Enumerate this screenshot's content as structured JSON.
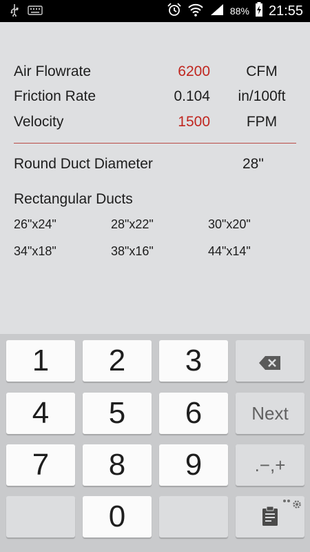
{
  "status_bar": {
    "battery_percent": "88%",
    "time": "21:55",
    "icons": [
      "usb-icon",
      "keyboard-icon",
      "alarm-icon",
      "wifi-icon",
      "signal-icon",
      "battery-charging-icon"
    ]
  },
  "calc": {
    "rows": [
      {
        "label": "Air Flowrate",
        "value": "6200",
        "unit": "CFM",
        "color": "#c0261f"
      },
      {
        "label": "Friction Rate",
        "value": "0.104",
        "unit": "in/100ft",
        "color": "#1d1d1d"
      },
      {
        "label": "Velocity",
        "value": "1500",
        "unit": "FPM",
        "color": "#c0261f"
      }
    ],
    "round_duct": {
      "label": "Round Duct Diameter",
      "value": "28\""
    },
    "rectangular": {
      "title": "Rectangular Ducts",
      "sizes": [
        "26\"x24\"",
        "28\"x22\"",
        "30\"x20\"",
        "34\"x18\"",
        "38\"x16\"",
        "44\"x14\""
      ]
    }
  },
  "keyboard": {
    "keys": [
      "1",
      "2",
      "3",
      "4",
      "5",
      "6",
      "7",
      "8",
      "9",
      "0"
    ],
    "next_label": "Next",
    "symbols_label": ".−,+",
    "backspace_icon": "backspace-icon",
    "clipboard_icon": "clipboard-icon",
    "settings_icon": "settings-gear-icon"
  }
}
